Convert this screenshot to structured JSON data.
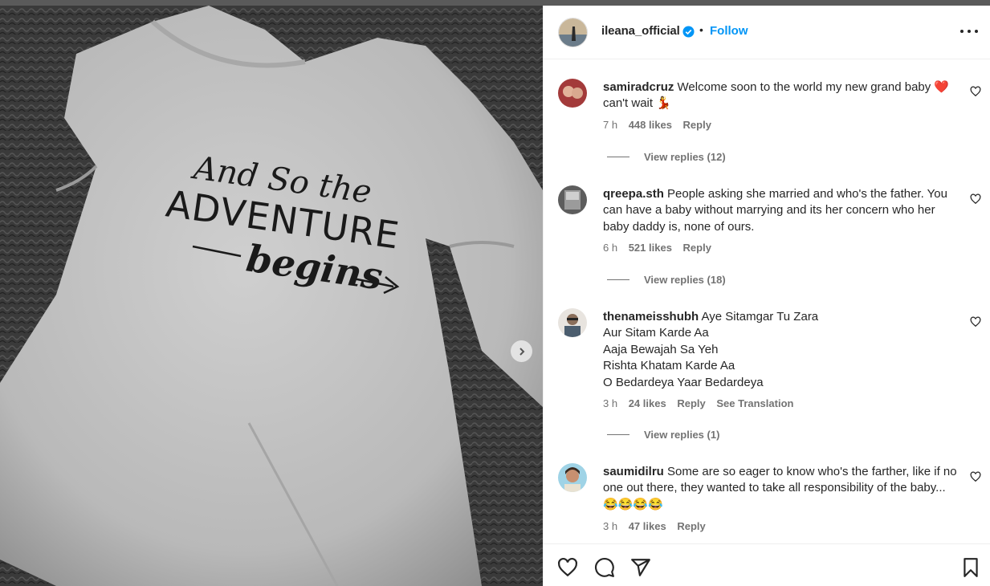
{
  "post": {
    "username": "ileana_official",
    "separator": "•",
    "follow_label": "Follow",
    "image_text": {
      "line1": "And So the",
      "line2": "ADVENTURE",
      "line3": "begins"
    }
  },
  "comments": [
    {
      "username": "samiradcruz",
      "text": "Welcome soon to the world my new grand baby ❤️ can't wait 💃",
      "time": "7 h",
      "likes": "448 likes",
      "reply": "Reply",
      "view_replies": "View replies (12)"
    },
    {
      "username": "qreepa.sth",
      "text": "People asking she married and who's the father. You can have a baby without marrying and its her concern who her baby daddy is, none of ours.",
      "time": "6 h",
      "likes": "521 likes",
      "reply": "Reply",
      "view_replies": "View replies (18)"
    },
    {
      "username": "thenameisshubh",
      "text_line1": "Aye Sitamgar Tu Zara",
      "text_line2": "Aur Sitam Karde Aa",
      "text_line3": "Aaja Bewajah Sa Yeh",
      "text_line4": "Rishta Khatam Karde Aa",
      "text_line5": "O Bedardeya Yaar Bedardeya",
      "time": "3 h",
      "likes": "24 likes",
      "reply": "Reply",
      "see_translation": "See Translation",
      "view_replies": "View replies (1)"
    },
    {
      "username": "saumidilru",
      "text": "Some are so eager to know who's the farther, like if no one out there, they wanted to take all responsibility of the baby...😂😂😂😂",
      "time": "3 h",
      "likes": "47 likes",
      "reply": "Reply"
    }
  ],
  "icons": [
    "heart-icon",
    "comment-icon",
    "share-icon",
    "bookmark-icon",
    "more-icon",
    "verified-icon",
    "chevron-right-icon"
  ],
  "colors": {
    "accent": "#0095f6",
    "text": "#262626",
    "muted": "#737373"
  }
}
